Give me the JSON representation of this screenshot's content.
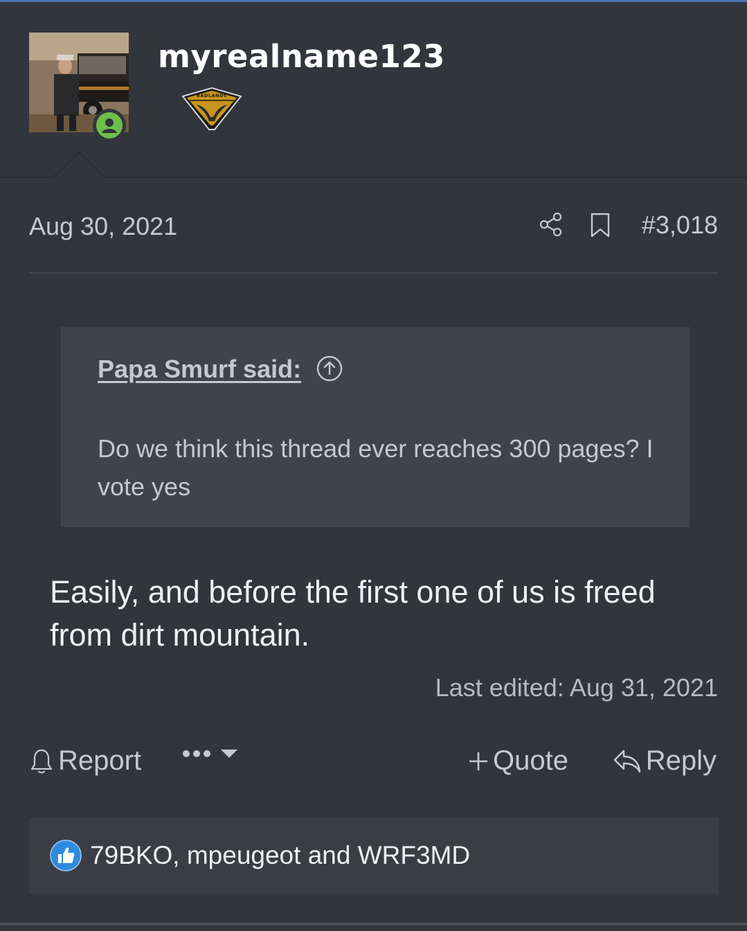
{
  "user": {
    "username": "myrealname123",
    "badge_text": "BADLANDS",
    "online": true
  },
  "post": {
    "date": "Aug 30, 2021",
    "number": "#3,018",
    "quote": {
      "author": "Papa Smurf said:",
      "body": "Do we think this thread ever reaches 300 pages? I vote yes"
    },
    "message": "Easily, and before the first one of us is freed from dirt mountain.",
    "last_edited": "Last edited: Aug 31, 2021"
  },
  "actions": {
    "report": "Report",
    "quote": "Quote",
    "reply": "Reply"
  },
  "reactions": {
    "icon": "like-icon",
    "users": "79BKO, mpeugeot and WRF3MD"
  },
  "colors": {
    "background": "#32353c",
    "accent": "#4a76b8",
    "online": "#6cc04a",
    "like": "#2f8be0"
  }
}
